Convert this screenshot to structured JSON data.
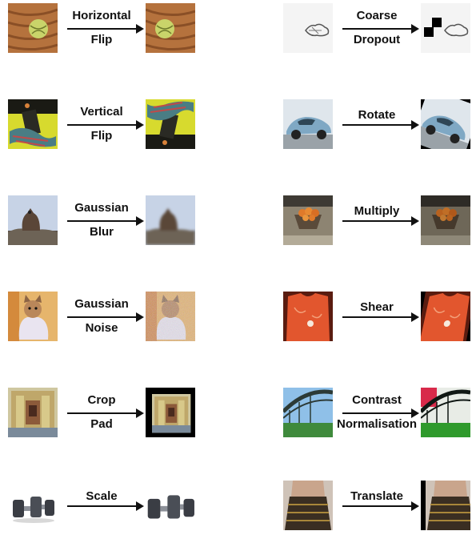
{
  "left_column": [
    {
      "line1": "Horizontal",
      "line2": "Flip"
    },
    {
      "line1": "Vertical",
      "line2": "Flip"
    },
    {
      "line1": "Gaussian",
      "line2": "Blur"
    },
    {
      "line1": "Gaussian",
      "line2": "Noise"
    },
    {
      "line1": "Crop",
      "line2": "Pad"
    },
    {
      "line1": "Scale",
      "line2": ""
    }
  ],
  "right_column": [
    {
      "line1": "Coarse",
      "line2": "Dropout"
    },
    {
      "line1": "Rotate",
      "line2": ""
    },
    {
      "line1": "Multiply",
      "line2": ""
    },
    {
      "line1": "Shear",
      "line2": ""
    },
    {
      "line1": "Contrast",
      "line2": "Normalisation"
    },
    {
      "line1": "Translate",
      "line2": ""
    }
  ]
}
